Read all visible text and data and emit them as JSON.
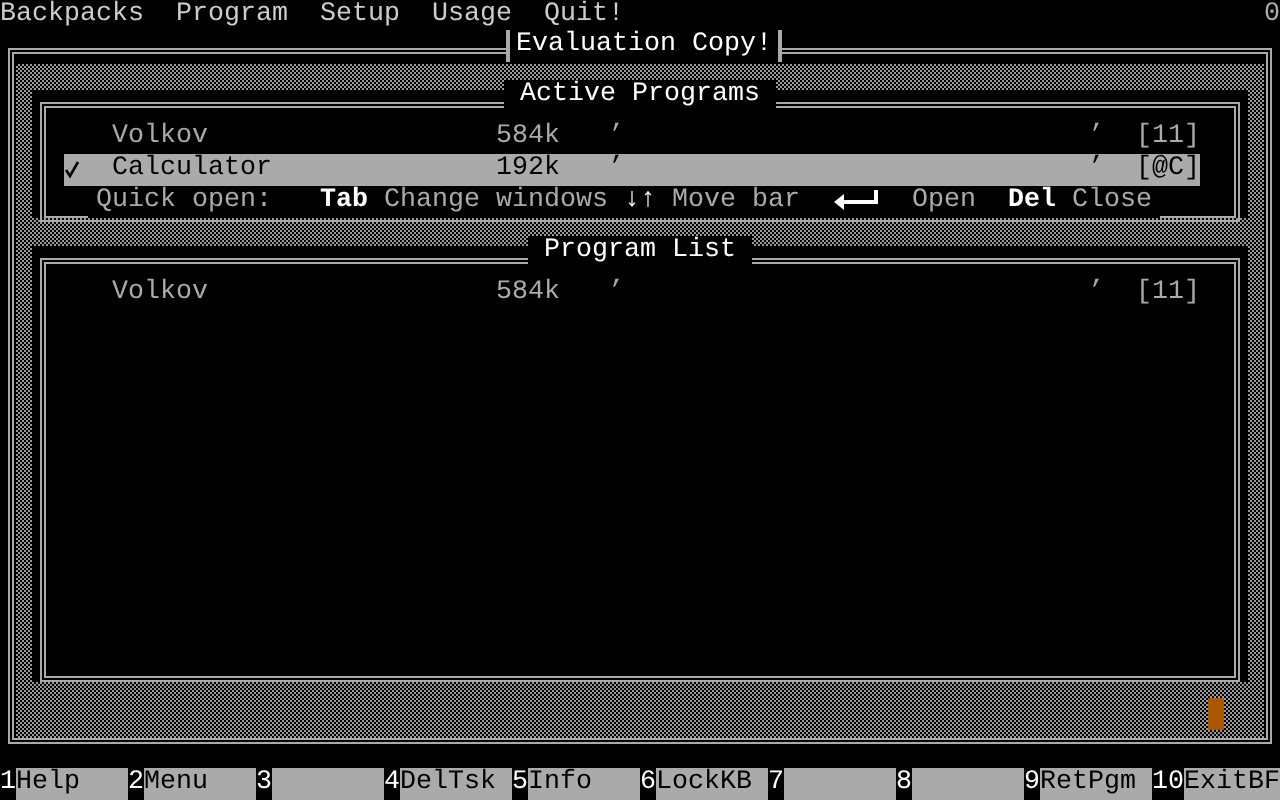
{
  "menu_bar": {
    "items": [
      "Backpacks",
      "Program",
      "Setup",
      "Usage",
      "Quit!"
    ],
    "indicator": "0"
  },
  "window": {
    "title": "Evaluation Copy!"
  },
  "active_programs": {
    "title": "Active Programs",
    "rows": [
      {
        "name": "Volkov",
        "size": "584k",
        "column_3": "’",
        "column_4": "’",
        "hotkey": "[11]",
        "selected": false,
        "checked": false
      },
      {
        "name": "Calculator",
        "size": "192k",
        "column_3": "’",
        "column_4": "’",
        "hotkey": "[@C]",
        "selected": true,
        "checked": true
      }
    ]
  },
  "quick_open": [
    {
      "kind": "text",
      "text": "Quick open:"
    },
    {
      "kind": "key",
      "text": "Tab"
    },
    {
      "kind": "text",
      "text": "Change windows"
    },
    {
      "kind": "key",
      "text": "↓↑"
    },
    {
      "kind": "text",
      "text": "Move bar"
    },
    {
      "kind": "enter-icon"
    },
    {
      "kind": "text",
      "text": "Open"
    },
    {
      "kind": "key",
      "text": "Del"
    },
    {
      "kind": "text",
      "text": "Close"
    }
  ],
  "program_list": {
    "title": "Program List",
    "rows": [
      {
        "name": "Volkov",
        "size": "584k",
        "column_3": "’",
        "column_4": "’",
        "hotkey": "[11]",
        "selected": false,
        "checked": false
      }
    ]
  },
  "function_keys": [
    {
      "number": "1",
      "label": "Help"
    },
    {
      "number": "2",
      "label": "Menu"
    },
    {
      "number": "3"
    },
    {
      "number": "4",
      "label": "DelTsk"
    },
    {
      "number": "5",
      "label": "Info"
    },
    {
      "number": "6",
      "label": "LockKB"
    },
    {
      "number": "7"
    },
    {
      "number": "8"
    },
    {
      "number": "9",
      "label": "RetPgm"
    },
    {
      "number": "10",
      "label": "ExitBF"
    }
  ]
}
